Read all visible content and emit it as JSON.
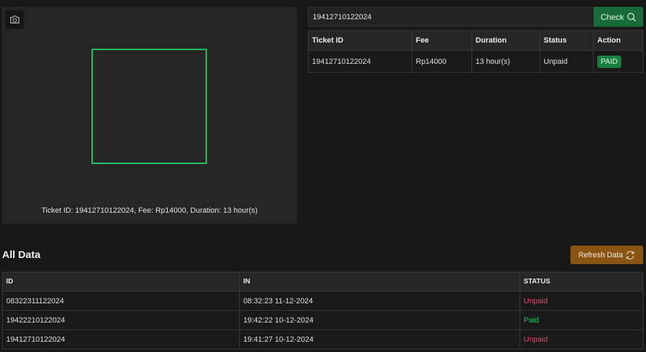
{
  "scanner": {
    "camera_icon": "camera-icon",
    "result_text": "Ticket ID: 19412710122024, Fee: Rp14000, Duration: 13 hour(s)",
    "frame_color": "#22c55e"
  },
  "search": {
    "value": "19412710122024",
    "check_label": "Check",
    "check_icon": "search-icon"
  },
  "ticket_table": {
    "headers": [
      "Ticket ID",
      "Fee",
      "Duration",
      "Status",
      "Action"
    ],
    "rows": [
      {
        "ticket_id": "19412710122024",
        "fee": "Rp14000",
        "duration": "13 hour(s)",
        "status": "Unpaid",
        "action_label": "PAID"
      }
    ]
  },
  "all_data": {
    "title": "All Data",
    "refresh_label": "Refresh Data",
    "refresh_icon": "refresh-icon",
    "headers": [
      "ID",
      "IN",
      "STATUS"
    ],
    "rows": [
      {
        "id": "08322311122024",
        "in": "08:32:23 11-12-2024",
        "status": "Unpaid"
      },
      {
        "id": "19422210122024",
        "in": "19:42:22 10-12-2024",
        "status": "Paid"
      },
      {
        "id": "19412710122024",
        "in": "19:41:27 10-12-2024",
        "status": "Unpaid"
      }
    ]
  },
  "colors": {
    "accent_green": "#1a6b3a",
    "paid_button": "#18803f",
    "refresh_button": "#8a5413",
    "status_unpaid": "#f43f5e",
    "status_paid": "#22c55e"
  }
}
